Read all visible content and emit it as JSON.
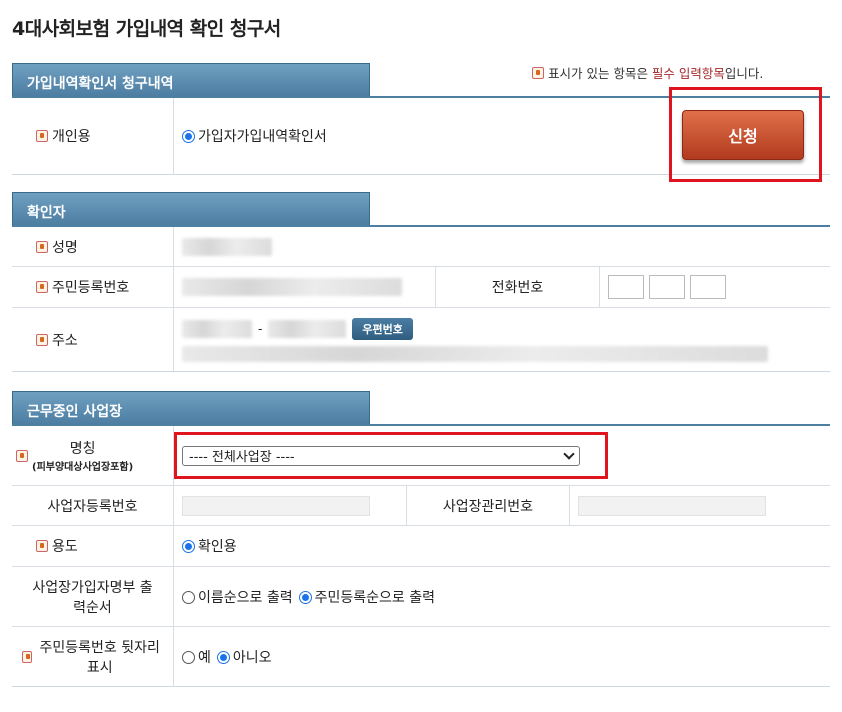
{
  "page": {
    "title": "4대사회보험 가입내역 확인 청구서"
  },
  "legend": {
    "before": "표시가 있는 항목은 ",
    "emphasis": "필수 입력항목",
    "after": "입니다."
  },
  "section_request": {
    "tab": "가입내역확인서 청구내역",
    "personal_label": "개인용",
    "personal_option": "가입자가입내역확인서",
    "submit_label": "신청"
  },
  "section_verifier": {
    "tab": "확인자",
    "name_label": "성명",
    "rrn_label": "주민등록번호",
    "phone_label": "전화번호",
    "address_label": "주소",
    "zip_button": "우편번호"
  },
  "section_workplace": {
    "tab": "근무중인 사업장",
    "name_label": "명칭",
    "name_sublabel": "(피부양대상사업장포함)",
    "workplace_select": "---- 전체사업장 ----",
    "biz_reg_label": "사업자등록번호",
    "biz_mgmt_label": "사업장관리번호",
    "purpose_label": "용도",
    "purpose_option": "확인용",
    "order_label": "사업장가입자명부 출력순서",
    "order_options": [
      "이름순으로 출력",
      "주민등록순으로 출력"
    ],
    "suffix_label": "주민등록번호 뒷자리 표시",
    "suffix_options": [
      "예",
      "아니오"
    ]
  },
  "colors": {
    "accent": "#4d7fa3",
    "submit": "#c9502e",
    "highlight": "#e0141e",
    "required_text": "#a52a2a"
  }
}
